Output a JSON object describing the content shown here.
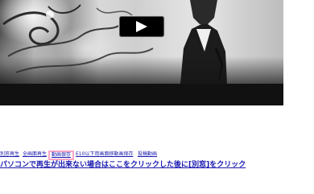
{
  "player": {
    "play_label": "play"
  },
  "links": [
    {
      "label": "別窓再生"
    },
    {
      "label": "全画面再生"
    },
    {
      "label": "動画保存"
    },
    {
      "label": "E10以下用画面移動画保存"
    },
    {
      "label": "投稿動画"
    }
  ],
  "notice": "パソコンで再生が出来ない場合はここをクリックした後に[別窓]をクリック",
  "colors": {
    "link": "#1a1ab0",
    "highlight_border": "#f8a5c8",
    "player_background": "#111111"
  },
  "icons": {
    "play": "play-icon"
  }
}
